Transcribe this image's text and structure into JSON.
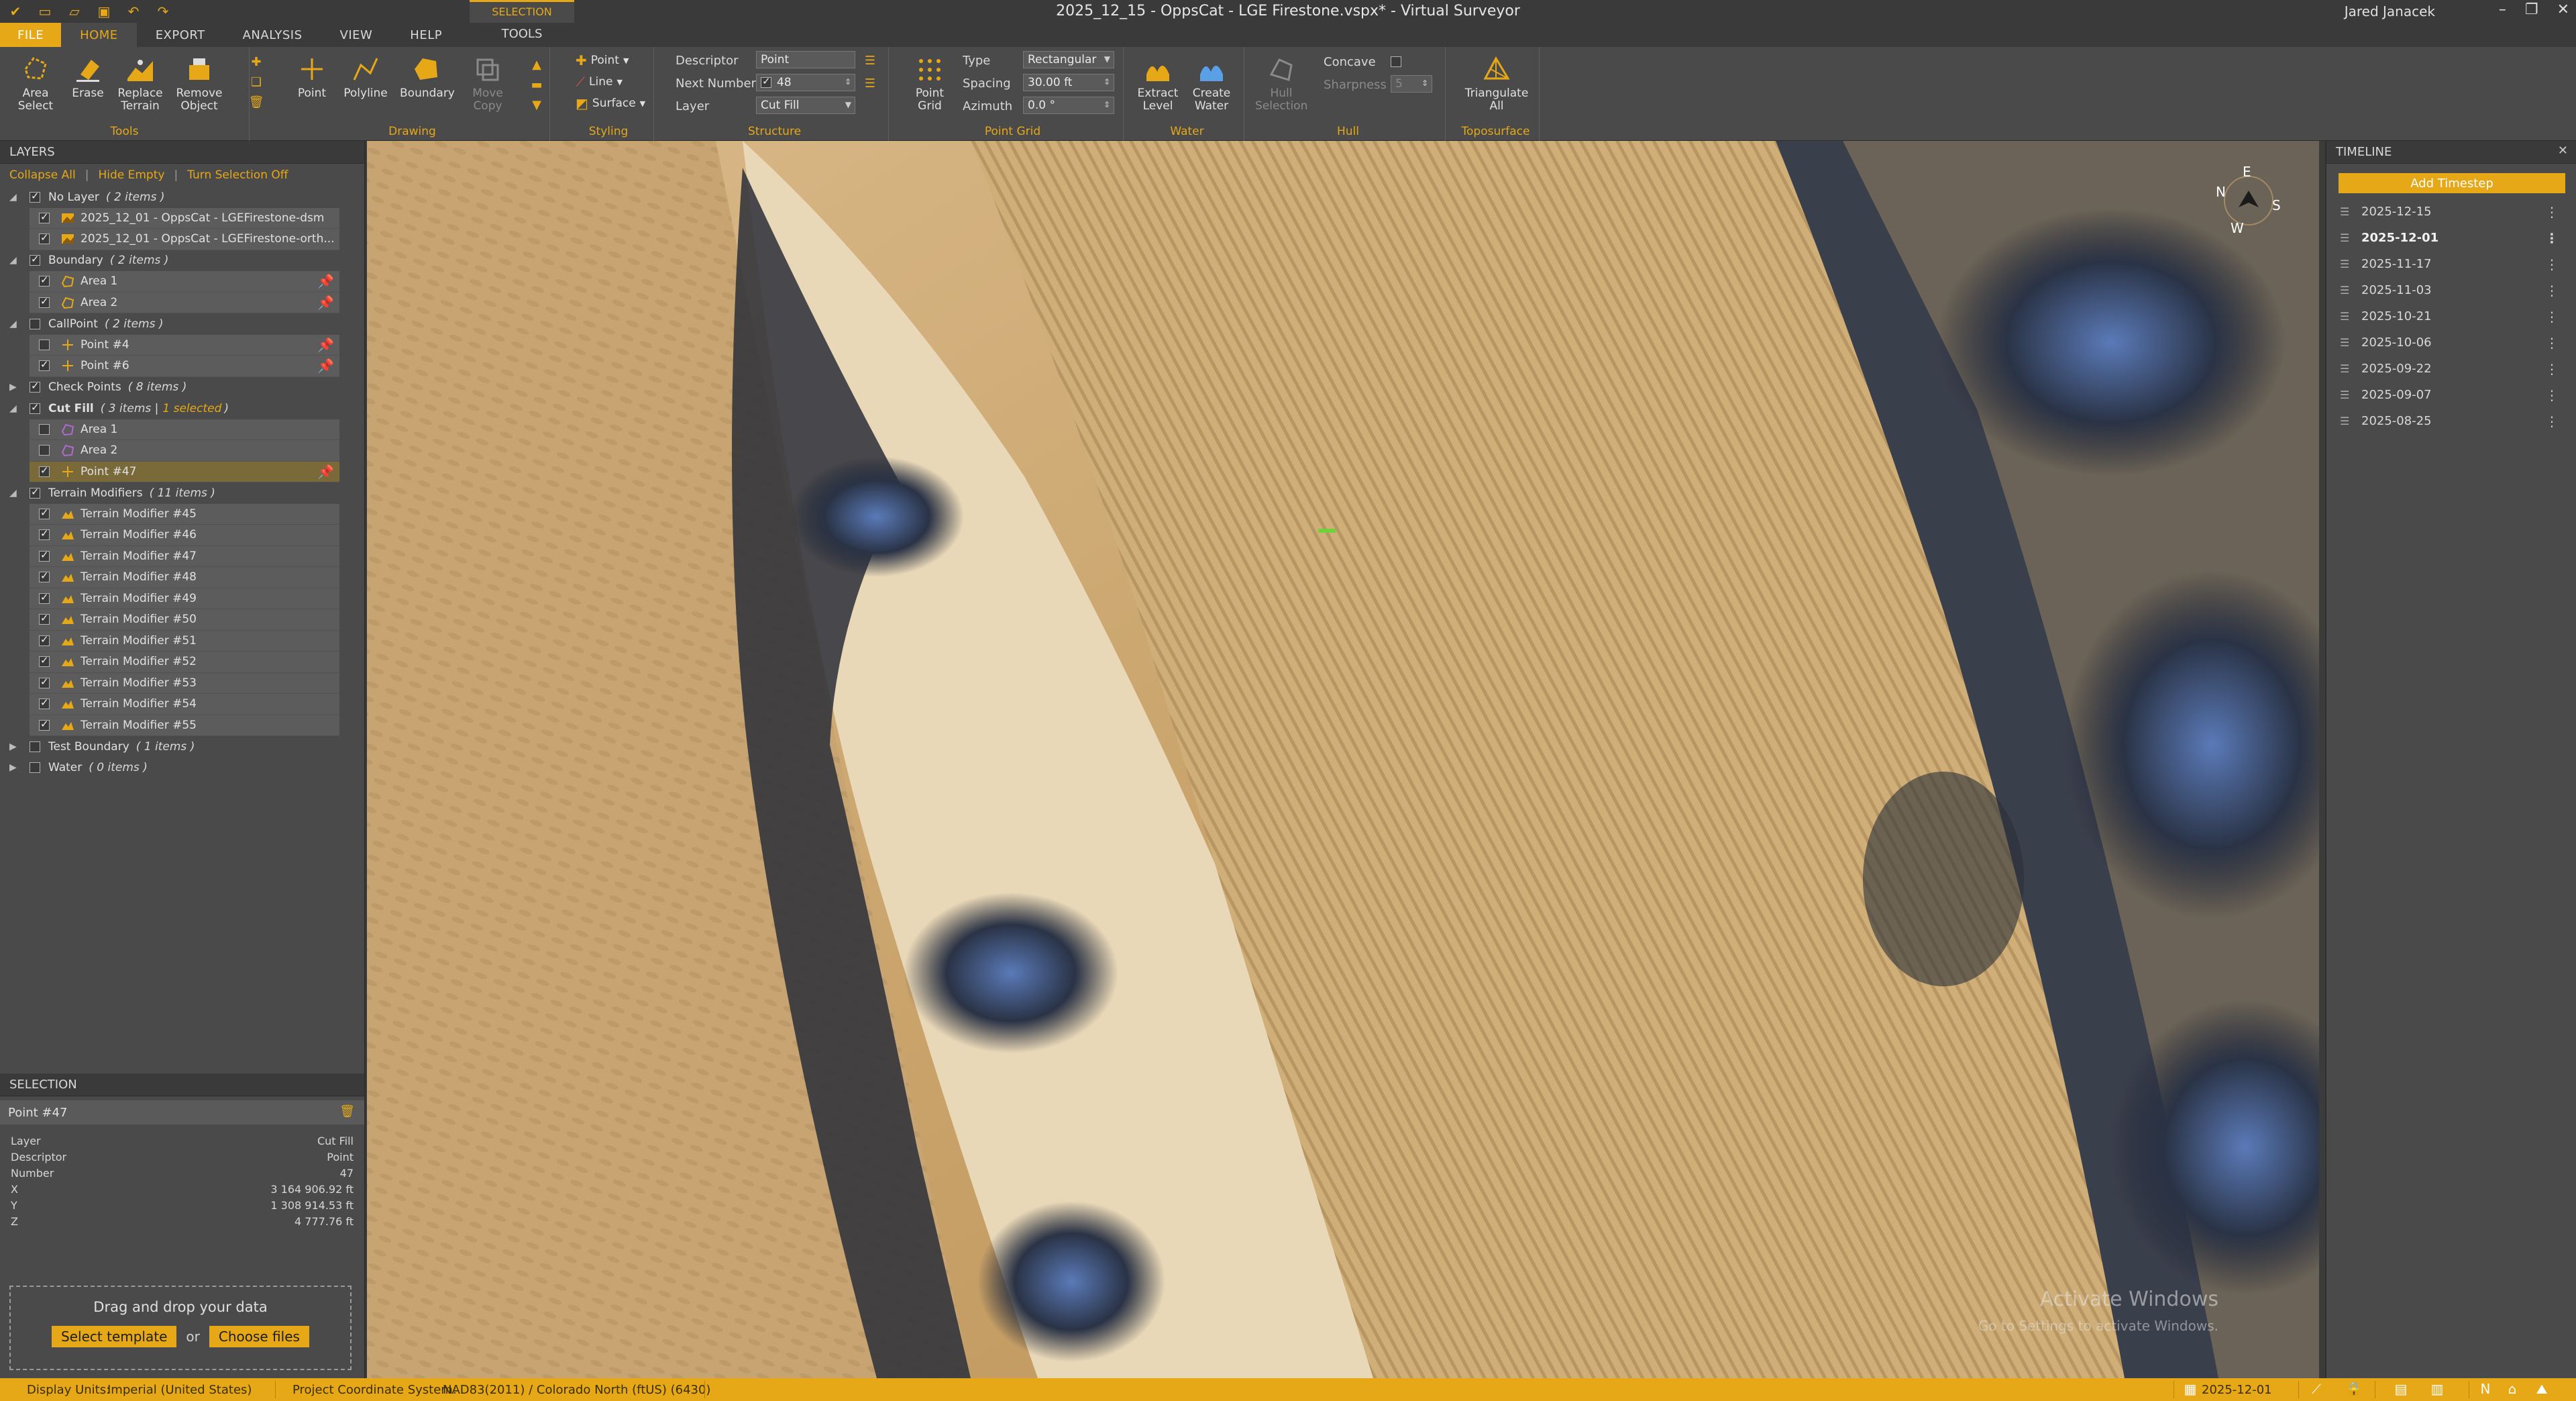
{
  "titlebar": {
    "title": "2025_12_15 - OppsCat - LGE Firestone.vspx* - Virtual Surveyor",
    "user": "Jared Janacek",
    "quick_access": [
      "app-logo-icon",
      "new-icon",
      "open-icon",
      "save-icon",
      "undo-icon",
      "redo-icon"
    ]
  },
  "tabs": {
    "file": "FILE",
    "home": "HOME",
    "export": "EXPORT",
    "analysis": "ANALYSIS",
    "view": "VIEW",
    "help": "HELP",
    "context_group": "SELECTION",
    "context_tab": "TOOLS"
  },
  "ribbon": {
    "tools": {
      "label": "Tools",
      "area_select": "Area\nSelect",
      "erase": "Erase",
      "replace_terrain": "Replace\nTerrain",
      "remove_object": "Remove\nObject"
    },
    "drawing": {
      "label": "Drawing",
      "point": "Point",
      "polyline": "Polyline",
      "boundary": "Boundary",
      "move_copy": "Move\nCopy"
    },
    "styling": {
      "label": "Styling",
      "point": "Point",
      "line": "Line",
      "surface": "Surface"
    },
    "structure": {
      "label": "Structure",
      "descriptor_label": "Descriptor",
      "descriptor_value": "Point",
      "next_number_label": "Next Number",
      "next_number_value": "48",
      "layer_label": "Layer",
      "layer_value": "Cut Fill"
    },
    "point_grid": {
      "label": "Point Grid",
      "button": "Point\nGrid",
      "type_label": "Type",
      "type_value": "Rectangular",
      "spacing_label": "Spacing",
      "spacing_value": "30.00 ft",
      "azimuth_label": "Azimuth",
      "azimuth_value": "0.0 °"
    },
    "water": {
      "label": "Water",
      "extract_level": "Extract\nLevel",
      "create_water": "Create\nWater"
    },
    "hull": {
      "label": "Hull",
      "hull_selection": "Hull\nSelection",
      "concave_label": "Concave",
      "sharpness_label": "Sharpness",
      "sharpness_value": "5"
    },
    "toposurface": {
      "label": "Toposurface",
      "triangulate": "Triangulate\nAll"
    }
  },
  "layers": {
    "header": "LAYERS",
    "collapse_all": "Collapse All",
    "hide_empty": "Hide Empty",
    "turn_selection_off": "Turn Selection Off",
    "rows": [
      {
        "kind": "group",
        "label": "No Layer",
        "count": "( 2 items )",
        "checked": true,
        "expanded": true
      },
      {
        "kind": "item",
        "label": "2025_12_01 - OppsCat - LGEFirestone-dsm",
        "checked": true,
        "icon": "raster"
      },
      {
        "kind": "item",
        "label": "2025_12_01 - OppsCat - LGEFirestone-orth...",
        "checked": true,
        "icon": "raster"
      },
      {
        "kind": "group",
        "label": "Boundary",
        "count": "( 2 items )",
        "checked": true,
        "expanded": true
      },
      {
        "kind": "item",
        "label": "Area 1",
        "checked": true,
        "icon": "area",
        "pin": true
      },
      {
        "kind": "item",
        "label": "Area 2",
        "checked": true,
        "icon": "area",
        "pin": true
      },
      {
        "kind": "group",
        "label": "CallPoint",
        "count": "( 2 items )",
        "checked": false,
        "expanded": true
      },
      {
        "kind": "item",
        "label": "Point #4",
        "checked": false,
        "icon": "point",
        "pin": true
      },
      {
        "kind": "item",
        "label": "Point #6",
        "checked": true,
        "icon": "point",
        "pin": true
      },
      {
        "kind": "group",
        "label": "Check Points",
        "count": "( 8 items )",
        "checked": true,
        "expanded": false
      },
      {
        "kind": "group",
        "label": "Cut Fill",
        "count": "( 3 items |",
        "selected": "1 selected",
        "checked": true,
        "expanded": true,
        "bold": true
      },
      {
        "kind": "item",
        "label": "Area 1",
        "checked": false,
        "icon": "area-purple"
      },
      {
        "kind": "item",
        "label": "Area 2",
        "checked": false,
        "icon": "area-purple"
      },
      {
        "kind": "item",
        "label": "Point #47",
        "checked": true,
        "icon": "point",
        "pin": true,
        "selected": true
      },
      {
        "kind": "group",
        "label": "Terrain Modifiers",
        "count": "( 11 items )",
        "checked": true,
        "expanded": true
      },
      {
        "kind": "item",
        "label": "Terrain Modifier #45",
        "checked": true,
        "icon": "terrain"
      },
      {
        "kind": "item",
        "label": "Terrain Modifier #46",
        "checked": true,
        "icon": "terrain"
      },
      {
        "kind": "item",
        "label": "Terrain Modifier #47",
        "checked": true,
        "icon": "terrain"
      },
      {
        "kind": "item",
        "label": "Terrain Modifier #48",
        "checked": true,
        "icon": "terrain"
      },
      {
        "kind": "item",
        "label": "Terrain Modifier #49",
        "checked": true,
        "icon": "terrain"
      },
      {
        "kind": "item",
        "label": "Terrain Modifier #50",
        "checked": true,
        "icon": "terrain"
      },
      {
        "kind": "item",
        "label": "Terrain Modifier #51",
        "checked": true,
        "icon": "terrain"
      },
      {
        "kind": "item",
        "label": "Terrain Modifier #52",
        "checked": true,
        "icon": "terrain"
      },
      {
        "kind": "item",
        "label": "Terrain Modifier #53",
        "checked": true,
        "icon": "terrain"
      },
      {
        "kind": "item",
        "label": "Terrain Modifier #54",
        "checked": true,
        "icon": "terrain"
      },
      {
        "kind": "item",
        "label": "Terrain Modifier #55",
        "checked": true,
        "icon": "terrain"
      },
      {
        "kind": "group",
        "label": "Test Boundary",
        "count": "( 1 items )",
        "checked": false,
        "expanded": false
      },
      {
        "kind": "group",
        "label": "Water",
        "count": "( 0 items )",
        "checked": false,
        "expanded": false
      }
    ]
  },
  "selection": {
    "header": "SELECTION",
    "title": "Point #47",
    "props": [
      {
        "k": "Layer",
        "v": "Cut Fill"
      },
      {
        "k": "Descriptor",
        "v": "Point"
      },
      {
        "k": "Number",
        "v": "47"
      },
      {
        "k": "X",
        "v": "3 164 906.92 ft"
      },
      {
        "k": "Y",
        "v": "1 308 914.53 ft"
      },
      {
        "k": "Z",
        "v": "4 777.76 ft"
      }
    ],
    "drop_text": "Drag and drop your data",
    "select_template": "Select template",
    "or": "or",
    "choose_files": "Choose files"
  },
  "viewport": {
    "compass": {
      "n": "N",
      "e": "E",
      "s": "S",
      "w": "W"
    },
    "watermark_title": "Activate Windows",
    "watermark_sub": "Go to Settings to activate Windows."
  },
  "timeline": {
    "header": "TIMELINE",
    "add_timestep": "Add Timestep",
    "dates": [
      "2025-12-15",
      "2025-12-01",
      "2025-11-17",
      "2025-11-03",
      "2025-10-21",
      "2025-10-06",
      "2025-09-22",
      "2025-09-07",
      "2025-08-25"
    ],
    "active_date": "2025-12-01"
  },
  "statusbar": {
    "display_units_label": "Display Units:",
    "display_units_value": "Imperial (United States)",
    "crs_label": "Project Coordinate System:",
    "crs_value": "NAD83(2011) / Colorado North (ftUS) (6430)",
    "date": "2025-12-01"
  },
  "colors": {
    "accent": "#e6a817",
    "panel": "#4a4a4a",
    "dark": "#3a3a3a"
  }
}
